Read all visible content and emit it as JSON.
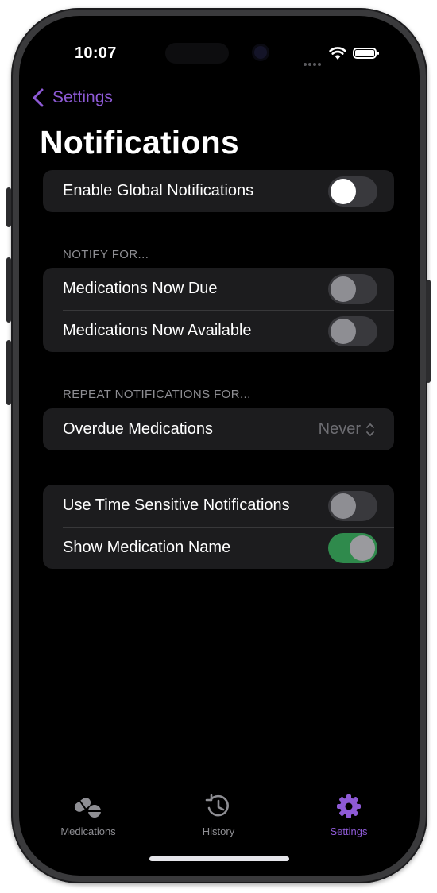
{
  "status_bar": {
    "time": "10:07"
  },
  "nav": {
    "back_label": "Settings",
    "title": "Notifications"
  },
  "global": {
    "enable_label": "Enable Global Notifications",
    "enabled": false
  },
  "notify_for": {
    "header": "NOTIFY FOR...",
    "items": [
      {
        "label": "Medications Now Due",
        "on": false
      },
      {
        "label": "Medications Now Available",
        "on": false
      }
    ]
  },
  "repeat": {
    "header": "REPEAT NOTIFICATIONS FOR...",
    "label": "Overdue Medications",
    "value": "Never"
  },
  "options": {
    "items": [
      {
        "label": "Use Time Sensitive Notifications",
        "on": false
      },
      {
        "label": "Show Medication Name",
        "on": true
      }
    ]
  },
  "tabs": [
    {
      "label": "Medications",
      "icon": "pills-icon",
      "active": false
    },
    {
      "label": "History",
      "icon": "history-icon",
      "active": false
    },
    {
      "label": "Settings",
      "icon": "gear-icon",
      "active": true
    }
  ],
  "colors": {
    "accent": "#8e5ad6",
    "toggle_on": "#2f8a4c",
    "group_bg": "#1c1c1e",
    "screen_bg": "#000000"
  }
}
